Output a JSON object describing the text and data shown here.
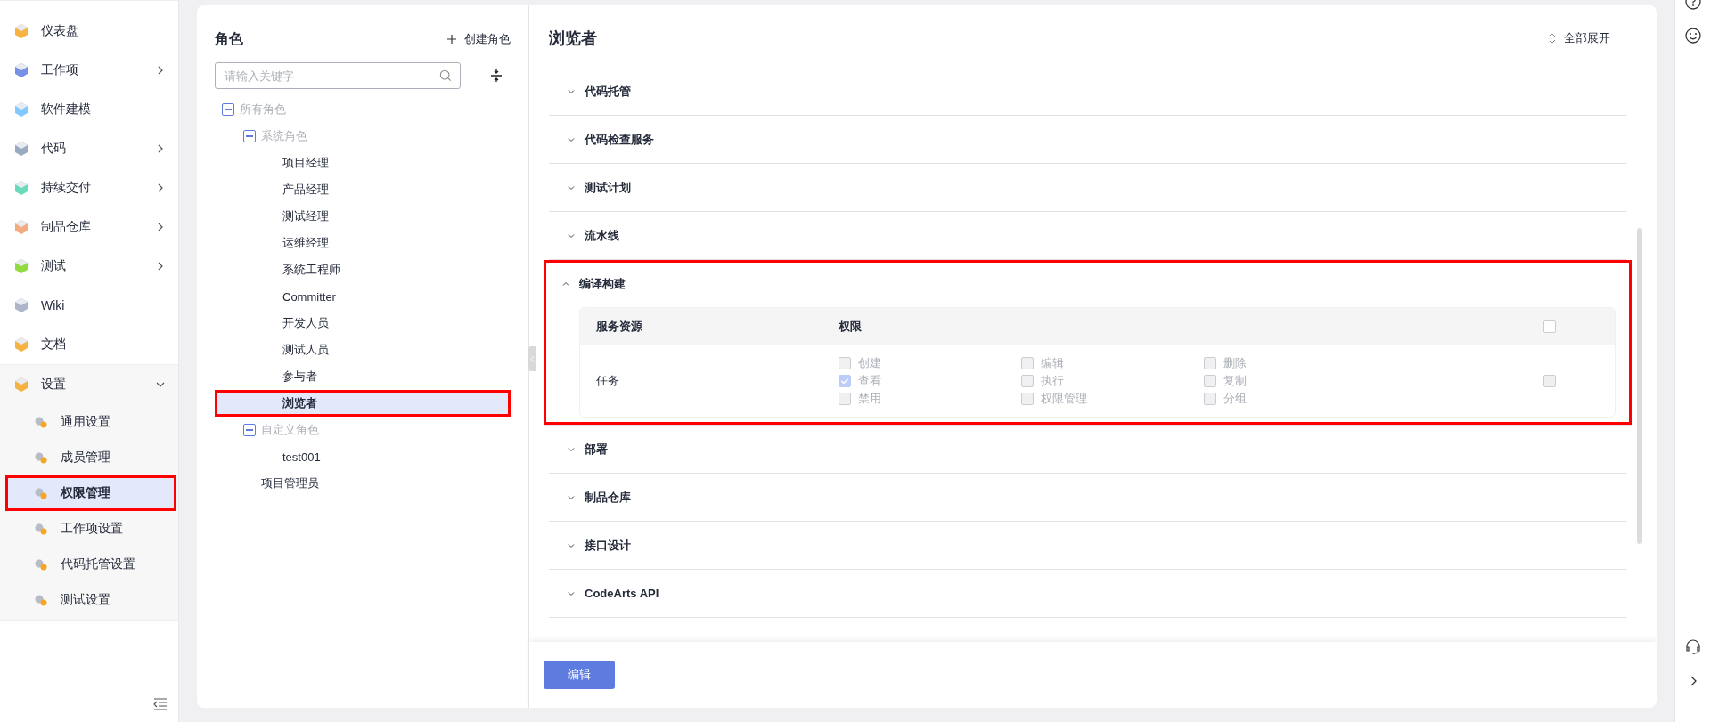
{
  "sidebar": {
    "items": [
      {
        "label": "仪表盘",
        "kind": "link",
        "selected": false,
        "highlighted": false
      },
      {
        "label": "工作项",
        "kind": "group",
        "expanded": false,
        "selected": false,
        "highlighted": false
      },
      {
        "label": "软件建模",
        "kind": "link",
        "selected": false,
        "highlighted": false
      },
      {
        "label": "代码",
        "kind": "group",
        "expanded": false,
        "selected": false,
        "highlighted": false
      },
      {
        "label": "持续交付",
        "kind": "group",
        "expanded": false,
        "selected": false,
        "highlighted": false
      },
      {
        "label": "制品仓库",
        "kind": "group",
        "expanded": false,
        "selected": false,
        "highlighted": false
      },
      {
        "label": "测试",
        "kind": "group",
        "expanded": false,
        "selected": false,
        "highlighted": false
      },
      {
        "label": "Wiki",
        "kind": "link",
        "selected": false,
        "highlighted": false
      },
      {
        "label": "文档",
        "kind": "link",
        "selected": false,
        "highlighted": false
      },
      {
        "label": "设置",
        "kind": "group",
        "expanded": true,
        "selected": false,
        "highlighted": false,
        "children": [
          {
            "label": "通用设置",
            "selected": false,
            "highlighted": false
          },
          {
            "label": "成员管理",
            "selected": false,
            "highlighted": false
          },
          {
            "label": "权限管理",
            "selected": true,
            "highlighted": true
          },
          {
            "label": "工作项设置",
            "selected": false,
            "highlighted": false
          },
          {
            "label": "代码托管设置",
            "selected": false,
            "highlighted": false
          },
          {
            "label": "测试设置",
            "selected": false,
            "highlighted": false
          }
        ]
      }
    ]
  },
  "roles": {
    "title": "角色",
    "create_button": "创建角色",
    "search": {
      "placeholder": "请输入关键字"
    },
    "tree": [
      {
        "label": "所有角色",
        "kind": "group",
        "expanded": true,
        "selected": false,
        "highlighted": false,
        "children": [
          {
            "label": "系统角色",
            "kind": "group",
            "expanded": true,
            "selected": false,
            "highlighted": false,
            "children": [
              {
                "label": "项目经理",
                "kind": "role",
                "selected": false,
                "highlighted": false
              },
              {
                "label": "产品经理",
                "kind": "role",
                "selected": false,
                "highlighted": false
              },
              {
                "label": "测试经理",
                "kind": "role",
                "selected": false,
                "highlighted": false
              },
              {
                "label": "运维经理",
                "kind": "role",
                "selected": false,
                "highlighted": false
              },
              {
                "label": "系统工程师",
                "kind": "role",
                "selected": false,
                "highlighted": false
              },
              {
                "label": "Committer",
                "kind": "role",
                "selected": false,
                "highlighted": false
              },
              {
                "label": "开发人员",
                "kind": "role",
                "selected": false,
                "highlighted": false
              },
              {
                "label": "测试人员",
                "kind": "role",
                "selected": false,
                "highlighted": false
              },
              {
                "label": "参与者",
                "kind": "role",
                "selected": false,
                "highlighted": false
              },
              {
                "label": "浏览者",
                "kind": "role",
                "selected": true,
                "highlighted": true
              }
            ]
          },
          {
            "label": "自定义角色",
            "kind": "group",
            "expanded": true,
            "selected": false,
            "highlighted": false,
            "children": [
              {
                "label": "test001",
                "kind": "role",
                "selected": false,
                "highlighted": false
              }
            ]
          },
          {
            "label": "项目管理员",
            "kind": "role",
            "selected": false,
            "highlighted": false
          }
        ]
      }
    ]
  },
  "detail": {
    "title": "浏览者",
    "expand_all": "全部展开",
    "sections": [
      {
        "title": "代码托管",
        "expanded": false,
        "highlighted": false
      },
      {
        "title": "代码检查服务",
        "expanded": false,
        "highlighted": false
      },
      {
        "title": "测试计划",
        "expanded": false,
        "highlighted": false
      },
      {
        "title": "流水线",
        "expanded": false,
        "highlighted": false
      },
      {
        "title": "编译构建",
        "expanded": true,
        "highlighted": true,
        "table": {
          "columns": [
            "服务资源",
            "权限"
          ],
          "all_checked": false,
          "rows": [
            {
              "resource": "任务",
              "checked": false,
              "permissions": [
                {
                  "label": "创建",
                  "checked": false,
                  "disabled": true
                },
                {
                  "label": "编辑",
                  "checked": false,
                  "disabled": true
                },
                {
                  "label": "删除",
                  "checked": false,
                  "disabled": true
                },
                {
                  "label": "查看",
                  "checked": true,
                  "disabled": true
                },
                {
                  "label": "执行",
                  "checked": false,
                  "disabled": true
                },
                {
                  "label": "复制",
                  "checked": false,
                  "disabled": true
                },
                {
                  "label": "禁用",
                  "checked": false,
                  "disabled": true
                },
                {
                  "label": "权限管理",
                  "checked": false,
                  "disabled": true
                },
                {
                  "label": "分组",
                  "checked": false,
                  "disabled": true
                }
              ]
            }
          ]
        }
      },
      {
        "title": "部署",
        "expanded": false,
        "highlighted": false
      },
      {
        "title": "制品仓库",
        "expanded": false,
        "highlighted": false
      },
      {
        "title": "接口设计",
        "expanded": false,
        "highlighted": false
      },
      {
        "title": "CodeArts API",
        "expanded": false,
        "highlighted": false
      }
    ],
    "edit_button": "编辑"
  }
}
